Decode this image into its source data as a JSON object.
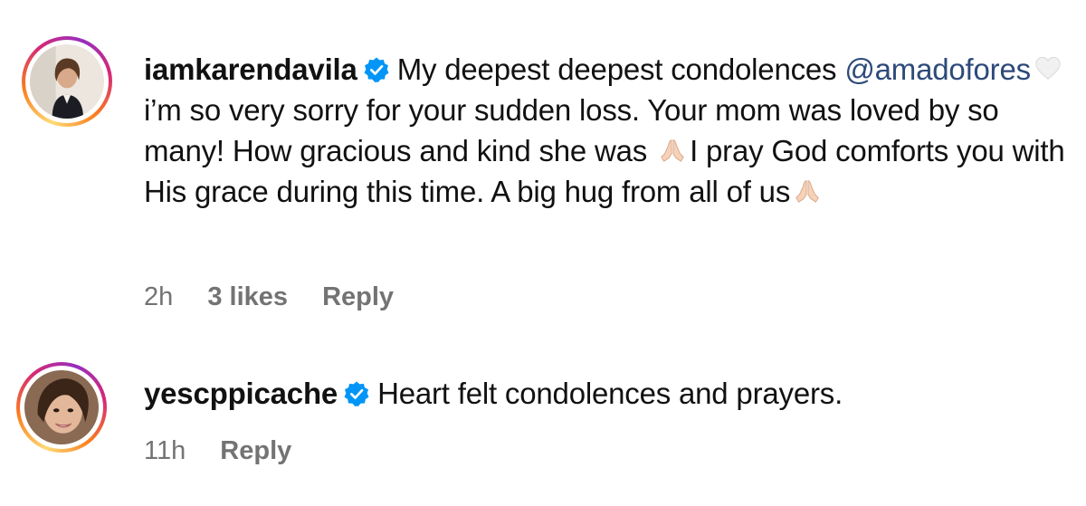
{
  "comments": [
    {
      "username": "iamkarendavila",
      "text_1": "My deepest deepest condolences",
      "mention": "@amadofores",
      "text_2": "i’m so very sorry for your sudden loss. Your mom was loved by so many! How gracious and kind she was",
      "text_3": "I pray God comforts you with His grace during this time. A big hug from all of us",
      "time": "2h",
      "likes": "3 likes",
      "reply": "Reply",
      "icons": [
        "white-heart-icon",
        "praying-hands-icon",
        "praying-hands-icon"
      ]
    },
    {
      "username": "yescppicache",
      "text_1": "Heart felt condolences and prayers.",
      "time": "11h",
      "reply": "Reply"
    }
  ],
  "colors": {
    "verified": "#0095f6",
    "meta": "#737373",
    "mention": "#2d4a7a"
  }
}
